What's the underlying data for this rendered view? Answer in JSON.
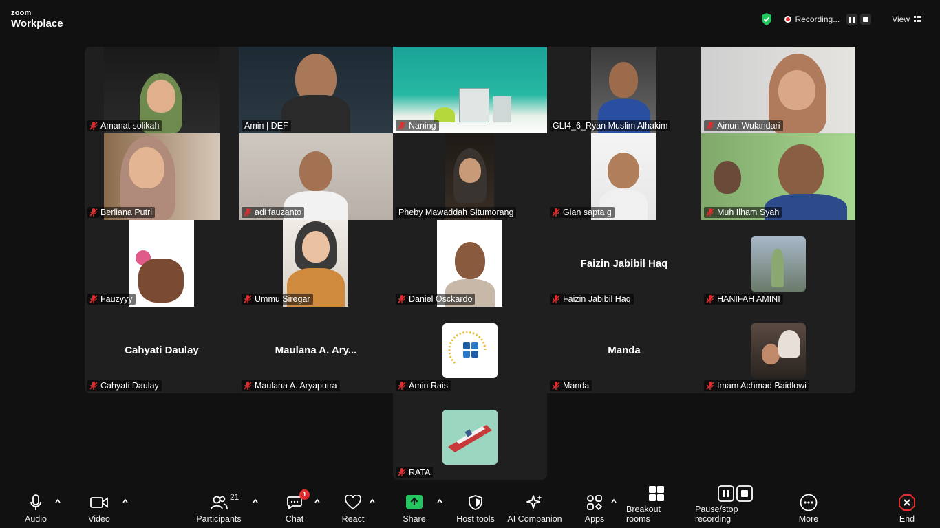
{
  "app": {
    "brand_top": "zoom",
    "brand_bottom": "Workplace"
  },
  "topbar": {
    "recording_label": "Recording...",
    "view_label": "View"
  },
  "participants": [
    {
      "name": "Amanat solikah",
      "muted": true
    },
    {
      "name": "Amin | DEF",
      "muted": false,
      "active": true
    },
    {
      "name": "Naning",
      "muted": true
    },
    {
      "name": "GLI4_6_Ryan Muslim Alhakim",
      "muted": false
    },
    {
      "name": "Ainun Wulandari",
      "muted": true
    },
    {
      "name": "Berliana Putri",
      "muted": true
    },
    {
      "name": "adi fauzanto",
      "muted": true
    },
    {
      "name": "Pheby Mawaddah Situmorang",
      "muted": false
    },
    {
      "name": "Gian sapta g",
      "muted": true
    },
    {
      "name": "Muh Ilham Syah",
      "muted": true
    },
    {
      "name": "Fauzyyy",
      "muted": true
    },
    {
      "name": "Ummu Siregar",
      "muted": true
    },
    {
      "name": "Daniel Osckardo",
      "muted": true
    },
    {
      "name": "Faizin Jabibil Haq",
      "muted": true,
      "center": "Faizin Jabibil Haq"
    },
    {
      "name": "HANIFAH AMINI",
      "muted": true
    },
    {
      "name": "Cahyati Daulay",
      "muted": true,
      "center": "Cahyati Daulay"
    },
    {
      "name": "Maulana A. Aryaputra",
      "muted": true,
      "center": "Maulana A. Ary..."
    },
    {
      "name": "Amin Rais",
      "muted": true
    },
    {
      "name": "Manda",
      "muted": true,
      "center": "Manda"
    },
    {
      "name": "Imam Achmad Baidlowi",
      "muted": true
    },
    {
      "name": "RATA",
      "muted": true
    }
  ],
  "toolbar": {
    "audio": "Audio",
    "video": "Video",
    "participants": "Participants",
    "participants_count": "21",
    "chat": "Chat",
    "chat_badge": "1",
    "react": "React",
    "share": "Share",
    "host_tools": "Host tools",
    "ai_companion": "AI Companion",
    "apps": "Apps",
    "breakout_rooms": "Breakout rooms",
    "pause_stop_recording": "Pause/stop recording",
    "more": "More",
    "end": "End"
  },
  "colors": {
    "active_speaker": "#3fd67f",
    "share_green": "#22c55e",
    "end_red": "#e02d2d",
    "tile_bg": "#1f1f1f"
  }
}
